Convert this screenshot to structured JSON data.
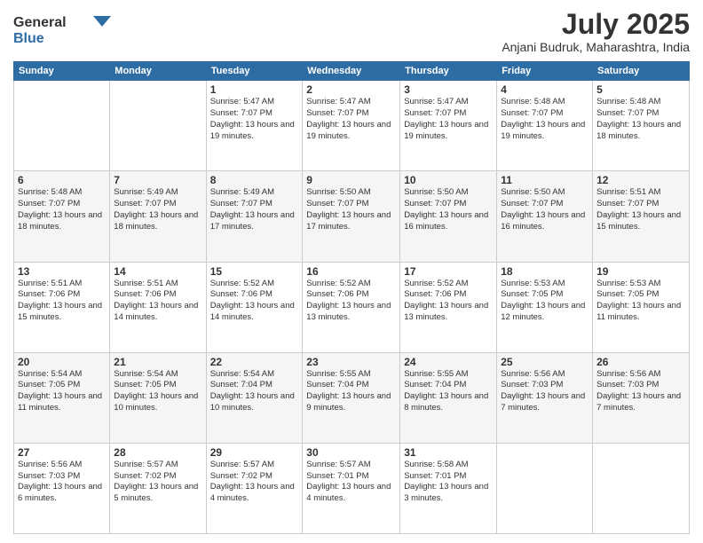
{
  "header": {
    "logo_general": "General",
    "logo_blue": "Blue",
    "month": "July 2025",
    "location": "Anjani Budruk, Maharashtra, India"
  },
  "weekdays": [
    "Sunday",
    "Monday",
    "Tuesday",
    "Wednesday",
    "Thursday",
    "Friday",
    "Saturday"
  ],
  "weeks": [
    [
      {
        "day": "",
        "info": ""
      },
      {
        "day": "",
        "info": ""
      },
      {
        "day": "1",
        "info": "Sunrise: 5:47 AM\nSunset: 7:07 PM\nDaylight: 13 hours\nand 19 minutes."
      },
      {
        "day": "2",
        "info": "Sunrise: 5:47 AM\nSunset: 7:07 PM\nDaylight: 13 hours\nand 19 minutes."
      },
      {
        "day": "3",
        "info": "Sunrise: 5:47 AM\nSunset: 7:07 PM\nDaylight: 13 hours\nand 19 minutes."
      },
      {
        "day": "4",
        "info": "Sunrise: 5:48 AM\nSunset: 7:07 PM\nDaylight: 13 hours\nand 19 minutes."
      },
      {
        "day": "5",
        "info": "Sunrise: 5:48 AM\nSunset: 7:07 PM\nDaylight: 13 hours\nand 18 minutes."
      }
    ],
    [
      {
        "day": "6",
        "info": "Sunrise: 5:48 AM\nSunset: 7:07 PM\nDaylight: 13 hours\nand 18 minutes."
      },
      {
        "day": "7",
        "info": "Sunrise: 5:49 AM\nSunset: 7:07 PM\nDaylight: 13 hours\nand 18 minutes."
      },
      {
        "day": "8",
        "info": "Sunrise: 5:49 AM\nSunset: 7:07 PM\nDaylight: 13 hours\nand 17 minutes."
      },
      {
        "day": "9",
        "info": "Sunrise: 5:50 AM\nSunset: 7:07 PM\nDaylight: 13 hours\nand 17 minutes."
      },
      {
        "day": "10",
        "info": "Sunrise: 5:50 AM\nSunset: 7:07 PM\nDaylight: 13 hours\nand 16 minutes."
      },
      {
        "day": "11",
        "info": "Sunrise: 5:50 AM\nSunset: 7:07 PM\nDaylight: 13 hours\nand 16 minutes."
      },
      {
        "day": "12",
        "info": "Sunrise: 5:51 AM\nSunset: 7:07 PM\nDaylight: 13 hours\nand 15 minutes."
      }
    ],
    [
      {
        "day": "13",
        "info": "Sunrise: 5:51 AM\nSunset: 7:06 PM\nDaylight: 13 hours\nand 15 minutes."
      },
      {
        "day": "14",
        "info": "Sunrise: 5:51 AM\nSunset: 7:06 PM\nDaylight: 13 hours\nand 14 minutes."
      },
      {
        "day": "15",
        "info": "Sunrise: 5:52 AM\nSunset: 7:06 PM\nDaylight: 13 hours\nand 14 minutes."
      },
      {
        "day": "16",
        "info": "Sunrise: 5:52 AM\nSunset: 7:06 PM\nDaylight: 13 hours\nand 13 minutes."
      },
      {
        "day": "17",
        "info": "Sunrise: 5:52 AM\nSunset: 7:06 PM\nDaylight: 13 hours\nand 13 minutes."
      },
      {
        "day": "18",
        "info": "Sunrise: 5:53 AM\nSunset: 7:05 PM\nDaylight: 13 hours\nand 12 minutes."
      },
      {
        "day": "19",
        "info": "Sunrise: 5:53 AM\nSunset: 7:05 PM\nDaylight: 13 hours\nand 11 minutes."
      }
    ],
    [
      {
        "day": "20",
        "info": "Sunrise: 5:54 AM\nSunset: 7:05 PM\nDaylight: 13 hours\nand 11 minutes."
      },
      {
        "day": "21",
        "info": "Sunrise: 5:54 AM\nSunset: 7:05 PM\nDaylight: 13 hours\nand 10 minutes."
      },
      {
        "day": "22",
        "info": "Sunrise: 5:54 AM\nSunset: 7:04 PM\nDaylight: 13 hours\nand 10 minutes."
      },
      {
        "day": "23",
        "info": "Sunrise: 5:55 AM\nSunset: 7:04 PM\nDaylight: 13 hours\nand 9 minutes."
      },
      {
        "day": "24",
        "info": "Sunrise: 5:55 AM\nSunset: 7:04 PM\nDaylight: 13 hours\nand 8 minutes."
      },
      {
        "day": "25",
        "info": "Sunrise: 5:56 AM\nSunset: 7:03 PM\nDaylight: 13 hours\nand 7 minutes."
      },
      {
        "day": "26",
        "info": "Sunrise: 5:56 AM\nSunset: 7:03 PM\nDaylight: 13 hours\nand 7 minutes."
      }
    ],
    [
      {
        "day": "27",
        "info": "Sunrise: 5:56 AM\nSunset: 7:03 PM\nDaylight: 13 hours\nand 6 minutes."
      },
      {
        "day": "28",
        "info": "Sunrise: 5:57 AM\nSunset: 7:02 PM\nDaylight: 13 hours\nand 5 minutes."
      },
      {
        "day": "29",
        "info": "Sunrise: 5:57 AM\nSunset: 7:02 PM\nDaylight: 13 hours\nand 4 minutes."
      },
      {
        "day": "30",
        "info": "Sunrise: 5:57 AM\nSunset: 7:01 PM\nDaylight: 13 hours\nand 4 minutes."
      },
      {
        "day": "31",
        "info": "Sunrise: 5:58 AM\nSunset: 7:01 PM\nDaylight: 13 hours\nand 3 minutes."
      },
      {
        "day": "",
        "info": ""
      },
      {
        "day": "",
        "info": ""
      }
    ]
  ]
}
